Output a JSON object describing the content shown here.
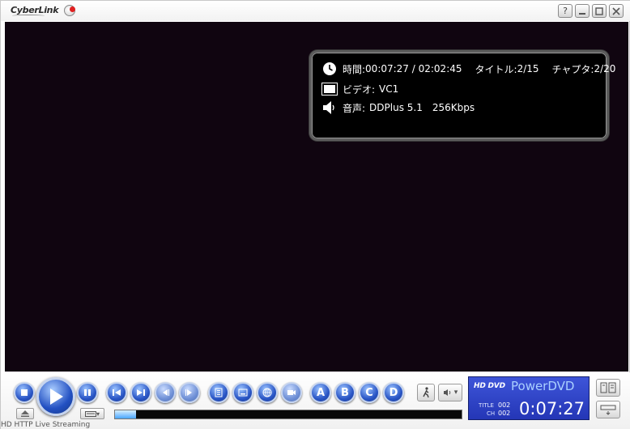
{
  "titlebar": {
    "logo_text": "CyberLink",
    "buttons": [
      "?",
      "—",
      "□",
      "✕"
    ]
  },
  "osd": {
    "time_label": "時間:",
    "time_value": "00:07:27 / 02:02:45",
    "title_label": "タイトル:",
    "title_value": "2/15",
    "chapter_label": "チャプタ:",
    "chapter_value": "2/20",
    "video_label": "ビデオ:",
    "video_value": "VC1",
    "audio_label": "音声:",
    "audio_codec": "DDPlus 5.1",
    "audio_bitrate": "256Kbps"
  },
  "controls": {
    "letters": [
      "A",
      "B",
      "C",
      "D"
    ],
    "seek_progress": 0.061,
    "bottom_text": "HD HTTP Live Streaming"
  },
  "display": {
    "hd_logo": "HD DVD",
    "brand": "PowerDVD",
    "title_label": "TITLE",
    "title_num": "002",
    "ch_label": "CH",
    "ch_num": "002",
    "time": "0:07:27"
  },
  "colors": {
    "video_bg": "#100510",
    "button_blue": "#2a56c6",
    "display_bg": "#2f45c8"
  }
}
